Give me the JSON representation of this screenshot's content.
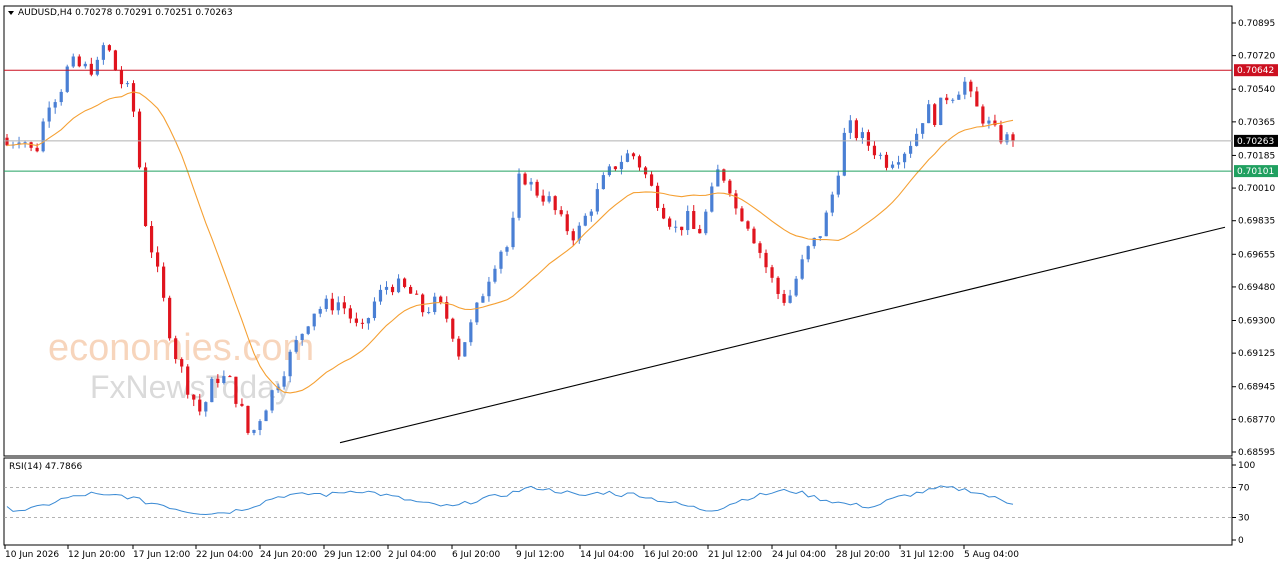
{
  "window": {
    "symbol_title": "AUDUSD,H4  0.70278 0.70291 0.70251 0.70263",
    "menu_arrow_icon": "triangle-down-icon"
  },
  "watermark": {
    "line1": "economies.com",
    "line2": "FxNewsToday"
  },
  "colors": {
    "bull": "#4a7fd4",
    "bear": "#e0141e",
    "ma": "#f5a033",
    "resistance": "#cc1020",
    "support": "#20a060",
    "current": "#b0b0b0",
    "trendline": "#000000",
    "rsi": "#3a8ad4",
    "rsi_levels": "#9a9a9a"
  },
  "chart_data": [
    {
      "type": "candlestick",
      "title": "AUDUSD,H4",
      "ohlc_header": {
        "open": 0.70278,
        "high": 0.70291,
        "low": 0.70251,
        "close": 0.70263
      },
      "ylim": [
        0.68595,
        0.70895
      ],
      "y_ticks": [
        "0.70895",
        "0.70720",
        "0.70540",
        "0.70365",
        "0.70185",
        "0.70010",
        "0.69835",
        "0.69655",
        "0.69480",
        "0.69300",
        "0.69125",
        "0.68945",
        "0.68770",
        "0.68595"
      ],
      "x_ticks": [
        "10 Jun 2026",
        "12 Jun 20:00",
        "17 Jun 12:00",
        "22 Jun 04:00",
        "24 Jun 20:00",
        "29 Jun 12:00",
        "2 Jul 04:00",
        "6 Jul 20:00",
        "9 Jul 12:00",
        "14 Jul 04:00",
        "16 Jul 20:00",
        "21 Jul 12:00",
        "24 Jul 04:00",
        "28 Jul 20:00",
        "31 Jul 12:00",
        "5 Aug 04:00"
      ],
      "candle_count": 168,
      "close_path": [
        [
          0,
          0.7024
        ],
        [
          8,
          0.703
        ],
        [
          16,
          0.7018
        ],
        [
          24,
          0.7048
        ],
        [
          30,
          0.7052
        ],
        [
          36,
          0.7068
        ],
        [
          44,
          0.7065
        ],
        [
          52,
          0.7066
        ],
        [
          56,
          0.7078
        ],
        [
          60,
          0.7072
        ],
        [
          64,
          0.706
        ],
        [
          72,
          0.705
        ],
        [
          80,
          0.6982
        ],
        [
          88,
          0.695
        ],
        [
          96,
          0.6915
        ],
        [
          104,
          0.6895
        ],
        [
          112,
          0.688
        ],
        [
          120,
          0.69
        ],
        [
          128,
          0.6898
        ],
        [
          136,
          0.688
        ],
        [
          140,
          0.6866
        ],
        [
          144,
          0.6875
        ],
        [
          152,
          0.689
        ],
        [
          160,
          0.6905
        ],
        [
          168,
          0.692
        ],
        [
          176,
          0.6935
        ],
        [
          184,
          0.6938
        ],
        [
          192,
          0.694
        ],
        [
          196,
          0.6935
        ],
        [
          204,
          0.6922
        ],
        [
          212,
          0.694
        ],
        [
          220,
          0.695
        ],
        [
          226,
          0.6948
        ],
        [
          232,
          0.6945
        ],
        [
          240,
          0.6935
        ],
        [
          248,
          0.694
        ],
        [
          256,
          0.6928
        ],
        [
          260,
          0.6912
        ],
        [
          268,
          0.6928
        ],
        [
          276,
          0.695
        ],
        [
          284,
          0.6968
        ],
        [
          290,
          0.697
        ],
        [
          296,
          0.701
        ],
        [
          304,
          0.7
        ],
        [
          312,
          0.6995
        ],
        [
          320,
          0.6982
        ],
        [
          328,
          0.6975
        ],
        [
          336,
          0.699
        ],
        [
          344,
          0.7005
        ],
        [
          352,
          0.7015
        ],
        [
          360,
          0.702
        ],
        [
          366,
          0.7012
        ],
        [
          372,
          0.7
        ],
        [
          378,
          0.699
        ],
        [
          386,
          0.6978
        ],
        [
          392,
          0.6985
        ],
        [
          398,
          0.6975
        ],
        [
          404,
          0.699
        ],
        [
          410,
          0.701
        ],
        [
          416,
          0.7005
        ],
        [
          420,
          0.699
        ],
        [
          426,
          0.6985
        ],
        [
          432,
          0.6972
        ],
        [
          438,
          0.6958
        ],
        [
          444,
          0.6945
        ],
        [
          450,
          0.694
        ],
        [
          456,
          0.6955
        ],
        [
          462,
          0.6968
        ],
        [
          468,
          0.6975
        ],
        [
          474,
          0.699
        ],
        [
          480,
          0.7015
        ],
        [
          484,
          0.7035
        ],
        [
          490,
          0.703
        ],
        [
          496,
          0.7025
        ],
        [
          502,
          0.702
        ],
        [
          506,
          0.7015
        ],
        [
          512,
          0.7018
        ],
        [
          518,
          0.7022
        ],
        [
          524,
          0.703
        ],
        [
          530,
          0.7044
        ],
        [
          536,
          0.7038
        ],
        [
          540,
          0.705
        ],
        [
          546,
          0.7052
        ],
        [
          552,
          0.7058
        ],
        [
          556,
          0.7048
        ],
        [
          560,
          0.7042
        ],
        [
          566,
          0.7035
        ],
        [
          570,
          0.703
        ],
        [
          574,
          0.7028
        ],
        [
          580,
          0.7026
        ]
      ],
      "horizontal_levels": [
        {
          "price": 0.70642,
          "label": "0.70642",
          "kind": "resistance"
        },
        {
          "price": 0.70263,
          "label": "0.70263",
          "kind": "current"
        },
        {
          "price": 0.70101,
          "label": "0.70101",
          "kind": "support"
        }
      ],
      "trendline": [
        [
          0.0,
          0.68645
        ],
        [
          1.0,
          0.698
        ]
      ],
      "moving_average": "orange"
    },
    {
      "type": "line",
      "title": "RSI(14) 47.7866",
      "indicator": "RSI(14)",
      "last_value": 47.7866,
      "ylim": [
        0,
        100
      ],
      "y_ticks": [
        "100",
        "70",
        "30",
        "0"
      ],
      "levels": [
        70,
        30
      ],
      "values": [
        [
          0,
          42
        ],
        [
          8,
          40
        ],
        [
          16,
          42
        ],
        [
          24,
          48
        ],
        [
          32,
          55
        ],
        [
          40,
          58
        ],
        [
          48,
          62
        ],
        [
          56,
          58
        ],
        [
          64,
          60
        ],
        [
          72,
          56
        ],
        [
          80,
          50
        ],
        [
          88,
          48
        ],
        [
          96,
          42
        ],
        [
          104,
          38
        ],
        [
          112,
          36
        ],
        [
          120,
          36
        ],
        [
          128,
          38
        ],
        [
          136,
          42
        ],
        [
          144,
          48
        ],
        [
          152,
          56
        ],
        [
          160,
          60
        ],
        [
          168,
          60
        ],
        [
          176,
          62
        ],
        [
          184,
          60
        ],
        [
          192,
          64
        ],
        [
          200,
          66
        ],
        [
          208,
          64
        ],
        [
          216,
          60
        ],
        [
          224,
          56
        ],
        [
          232,
          52
        ],
        [
          240,
          48
        ],
        [
          248,
          46
        ],
        [
          256,
          44
        ],
        [
          264,
          50
        ],
        [
          272,
          55
        ],
        [
          280,
          58
        ],
        [
          288,
          62
        ],
        [
          296,
          68
        ],
        [
          304,
          70
        ],
        [
          312,
          66
        ],
        [
          320,
          64
        ],
        [
          328,
          58
        ],
        [
          336,
          62
        ],
        [
          344,
          64
        ],
        [
          352,
          60
        ],
        [
          360,
          62
        ],
        [
          368,
          56
        ],
        [
          376,
          52
        ],
        [
          384,
          48
        ],
        [
          392,
          44
        ],
        [
          400,
          40
        ],
        [
          408,
          42
        ],
        [
          416,
          50
        ],
        [
          424,
          56
        ],
        [
          432,
          60
        ],
        [
          440,
          64
        ],
        [
          448,
          66
        ],
        [
          456,
          62
        ],
        [
          464,
          56
        ],
        [
          472,
          52
        ],
        [
          480,
          48
        ],
        [
          488,
          46
        ],
        [
          496,
          44
        ],
        [
          504,
          52
        ],
        [
          512,
          58
        ],
        [
          520,
          62
        ],
        [
          528,
          66
        ],
        [
          536,
          70
        ],
        [
          544,
          68
        ],
        [
          552,
          66
        ],
        [
          560,
          60
        ],
        [
          568,
          54
        ],
        [
          576,
          47.79
        ]
      ]
    }
  ]
}
